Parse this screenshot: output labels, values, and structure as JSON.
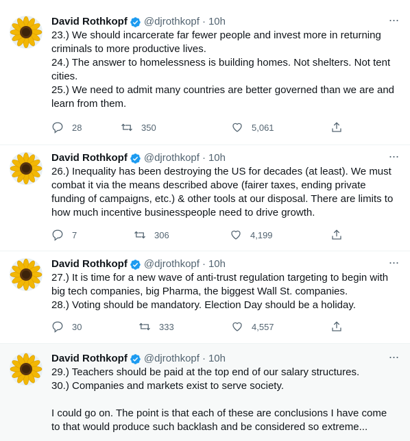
{
  "tweets": [
    {
      "name": "David Rothkopf",
      "handle": "@djrothkopf",
      "time": "10h",
      "lines": [
        "23.) We should incarcerate far fewer people and invest more in returning",
        "criminals to more productive lives.",
        "24.) The answer to homelessness is building homes. Not shelters. Not tent",
        "cities.",
        "25.) We need to admit many countries are better governed than we are and",
        "learn from them."
      ],
      "replies": "28",
      "retweets": "350",
      "likes": "5,061"
    },
    {
      "name": "David Rothkopf",
      "handle": "@djrothkopf",
      "time": "10h",
      "lines": [
        "26.) Inequality has been destroying the US for decades (at least). We must",
        "combat it via the means described above (fairer taxes, ending private",
        "funding of campaigns, etc.) & other tools at our disposal. There are limits to",
        "how much incentive businesspeople need to drive growth."
      ],
      "replies": "7",
      "retweets": "306",
      "likes": "4,199"
    },
    {
      "name": "David Rothkopf",
      "handle": "@djrothkopf",
      "time": "10h",
      "lines": [
        "27.) It is time for a new wave of anti-trust regulation targeting to begin with",
        "big tech companies, big Pharma, the biggest Wall St. companies.",
        "28.) Voting should be mandatory. Election Day should be a holiday."
      ],
      "replies": "30",
      "retweets": "333",
      "likes": "4,557"
    },
    {
      "name": "David Rothkopf",
      "handle": "@djrothkopf",
      "time": "10h",
      "lines": [
        "29.) Teachers should be paid at the top end of our salary structures.",
        "30.) Companies and markets exist to serve society.",
        "",
        "I could go on. The point is that each of these are conclusions I have come",
        "to that would produce such backlash and be considered so extreme..."
      ]
    }
  ],
  "colors": {
    "verified": "#1d9bf0",
    "secondary_text": "#536471",
    "highlight_bg": "#f7f9f9"
  }
}
